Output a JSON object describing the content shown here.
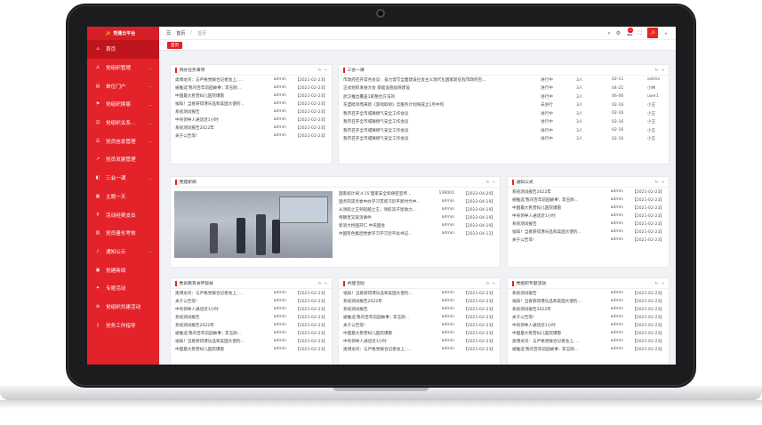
{
  "app": {
    "title": "党建云平台"
  },
  "sidebar": {
    "items": [
      {
        "label": "首页",
        "icon": "home-icon"
      },
      {
        "label": "党组织管理",
        "icon": "user-icon",
        "arrow": true
      },
      {
        "label": "单位门户",
        "icon": "doc-icon",
        "arrow": true
      },
      {
        "label": "党组织换届",
        "icon": "flag-icon",
        "arrow": true
      },
      {
        "label": "党组织关系...",
        "icon": "people-icon",
        "arrow": true
      },
      {
        "label": "党员信息管理",
        "icon": "list-icon",
        "arrow": true
      },
      {
        "label": "党员发展管理",
        "icon": "growth-icon"
      },
      {
        "label": "三会一课",
        "icon": "meeting-icon",
        "arrow": true
      },
      {
        "label": "主题一天",
        "icon": "calendar-icon"
      },
      {
        "label": "活动经费支出",
        "icon": "money-icon"
      },
      {
        "label": "党员量化考核",
        "icon": "chart-icon"
      },
      {
        "label": "通知公示",
        "icon": "bell-icon",
        "arrow": true
      },
      {
        "label": "党建新闻",
        "icon": "news-icon"
      },
      {
        "label": "专题活动",
        "icon": "star-icon"
      },
      {
        "label": "党组织共建活动",
        "icon": "link-icon"
      },
      {
        "label": "党务工作指导",
        "icon": "book-icon"
      }
    ]
  },
  "header": {
    "breadcrumb_home": "首页",
    "breadcrumb_sep": "/",
    "breadcrumb_current": "首页",
    "badge": "5"
  },
  "tabs": [
    {
      "label": "首页"
    }
  ],
  "cards": {
    "todo": {
      "title": "待办任务事项",
      "rows": [
        [
          "奥博龙司：与严格党联合记者会上, ...",
          "admin",
          "【2021-02-23】"
        ],
        [
          "被推选'我司百年前园故事', 李玉刚...",
          "admin",
          "【2021-02-23】"
        ],
        [
          "中国最大民营妇儿医院爆雷",
          "admin",
          "【2021-02-23】"
        ],
        [
          "福知！当春获得港乐品和美国大使的...",
          "admin",
          "【2021-02-23】"
        ],
        [
          "系统测试报告",
          "admin",
          "【2021-02-23】"
        ],
        [
          "中央领导人通话近1小时",
          "admin",
          "【2021-02-23】"
        ],
        [
          "系统测试报告2022年",
          "admin",
          "【2021-02-23】"
        ],
        [
          "关于公告等!",
          "admin",
          "【2021-02-23】"
        ]
      ]
    },
    "sanhui": {
      "title": "三会一课",
      "rows": [
        [
          "市政府召开常务会议：奋力谱写全面建设社会主义现代化国家新征程市政府召...",
          "进行中",
          "3人",
          "02-11",
          "admin"
        ],
        [
          "正式组织发展大会 基础设施加快建设",
          "进行中",
          "3人",
          "04-21",
          "小林"
        ],
        [
          "武汉推出覆盖1家整合方法的",
          "进行中",
          "3人",
          "06-06",
          "user1"
        ],
        [
          "东盟睦邻而来新《游戏取缔》云服务计划将成立1月中旬",
          "未进行",
          "3人",
          "02-16",
          "小王"
        ],
        [
          "我市召开全市城镇燃气安全工作会议",
          "进行中",
          "3人",
          "02-16",
          "小王"
        ],
        [
          "我市召开全市城镇燃气安全工作会议",
          "进行中",
          "3人",
          "02-16",
          "小王"
        ],
        [
          "我市召开全市城镇燃气安全工作会议",
          "进行中",
          "3人",
          "02-16",
          "小王"
        ],
        [
          "我市召开全市城镇燃气安全工作会议",
          "进行中",
          "3人",
          "02-16",
          "小王"
        ]
      ]
    },
    "news": {
      "title": "党建新闻",
      "rows": [
        [
          "国家统计局'4·15'国家安全和保密宣传...",
          "139001",
          "【2023-04-20】"
        ],
        [
          "国务院常务委中办学习贯彻习近平新时代中...",
          "admin",
          "【2023-04-19】"
        ],
        [
          "从领航之王到轻越之王，领航双子星助力...",
          "admin",
          "【2023-04-19】"
        ],
        [
          "特朗普又取消事件",
          "admin",
          "【2023-04-19】"
        ],
        [
          "新浪大桥国开仁 中央国会",
          "admin",
          "【2023-04-19】"
        ],
        [
          "中国有色集团党委学习学习近平总书记...",
          "admin",
          "【2023-04-12】"
        ]
      ]
    },
    "notice": {
      "title": "通知公式",
      "rows": [
        [
          "系统测试报告2022年",
          "admin",
          "【2021-02-23】"
        ],
        [
          "被推选'我司百年前园故事', 李玉刚...",
          "admin",
          "【2021-02-23】"
        ],
        [
          "中国最大民营妇儿医院爆雷",
          "admin",
          "【2021-02-23】"
        ],
        [
          "中央领导人通话近1小时",
          "admin",
          "【2021-02-23】"
        ],
        [
          "系统测试报告",
          "admin",
          "【2021-02-23】"
        ],
        [
          "福知！当春获得港乐品和美国大使的...",
          "admin",
          "【2021-02-23】"
        ],
        [
          "关于公告等!",
          "admin",
          "【2021-02-23】"
        ]
      ]
    },
    "party": {
      "title": "党员教育关怀帮扶",
      "rows": [
        [
          "奥博龙司：与严格党联合记者会上, ...",
          "admin",
          "【2021-02-23】"
        ],
        [
          "关于公告等!",
          "admin",
          "【2021-02-23】"
        ],
        [
          "中央领导人通话近1小时",
          "admin",
          "【2021-02-23】"
        ],
        [
          "系统测试报告",
          "admin",
          "【2021-02-23】"
        ],
        [
          "系统测试报告2022年",
          "admin",
          "【2021-02-23】"
        ],
        [
          "被推选'我司百年前园故事', 李玉刚...",
          "admin",
          "【2021-02-23】"
        ],
        [
          "福知！当春获得港乐品和美国大使的...",
          "admin",
          "【2021-02-23】"
        ],
        [
          "中国最大民营妇儿医院爆雷",
          "admin",
          "【2021-02-23】"
        ]
      ]
    },
    "coop": {
      "title": "共建活动",
      "rows": [
        [
          "福知！当春获得港乐品和美国大使的...",
          "admin",
          "【2021-02-23】"
        ],
        [
          "系统测试报告2022年",
          "admin",
          "【2021-02-23】"
        ],
        [
          "系统测试报告",
          "admin",
          "【2021-02-23】"
        ],
        [
          "被推选'我司百年前园故事', 李玉刚...",
          "admin",
          "【2021-02-23】"
        ],
        [
          "关于公告等!",
          "admin",
          "【2021-02-23】"
        ],
        [
          "中国最大民营妇儿医院爆雷",
          "admin",
          "【2021-02-23】"
        ],
        [
          "中央领导人通话近1小时",
          "admin",
          "【2021-02-23】"
        ],
        [
          "奥博龙司：与严格党联合记者会上, ...",
          "admin",
          "【2021-02-23】"
        ]
      ]
    },
    "special": {
      "title": "党组织专题活动",
      "rows": [
        [
          "系统测试报告",
          "admin",
          "【2021-02-23】"
        ],
        [
          "福知！当春获得港乐品和美国大使的...",
          "admin",
          "【2021-02-23】"
        ],
        [
          "系统测试报告2022年",
          "admin",
          "【2021-02-23】"
        ],
        [
          "关于公告等!",
          "admin",
          "【2021-02-23】"
        ],
        [
          "中央领导人通话近1小时",
          "admin",
          "【2021-02-23】"
        ],
        [
          "中国最大民营妇儿医院爆雷",
          "admin",
          "【2021-02-23】"
        ],
        [
          "奥博龙司：与严格党联合记者会上, ...",
          "admin",
          "【2021-02-23】"
        ],
        [
          "被推选'我司百年前园故事', 李玉刚...",
          "admin",
          "【2021-02-23】"
        ]
      ]
    }
  },
  "colors": {
    "primary": "#e4222a",
    "sidebar_active": "#c0151d"
  }
}
